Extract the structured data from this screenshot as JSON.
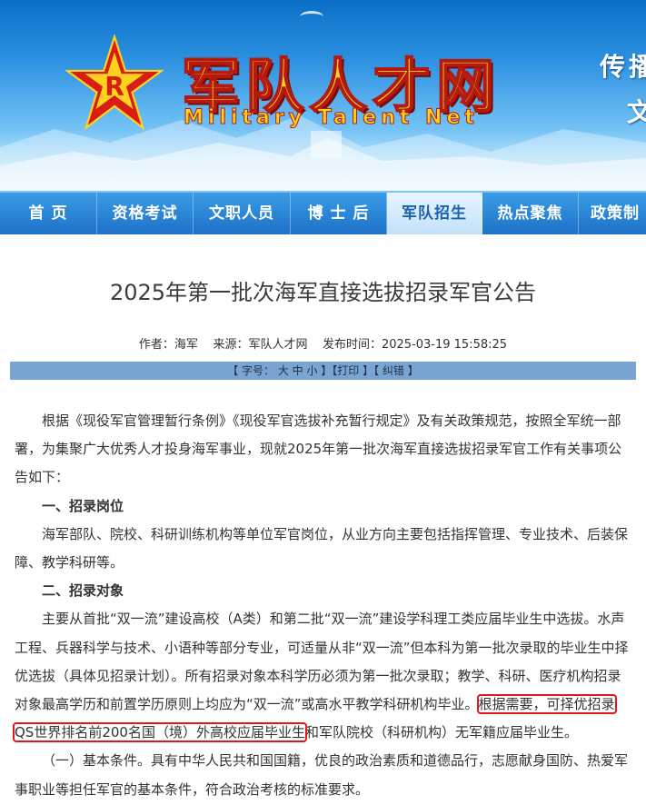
{
  "banner": {
    "logo_cn": "军队人才网",
    "logo_en": "Military Talent Net",
    "slogan_line1": "传播",
    "slogan_line2": "文"
  },
  "nav": {
    "items": [
      {
        "label": "首 页",
        "active": false
      },
      {
        "label": "资格考试",
        "active": false
      },
      {
        "label": "文职人员",
        "active": false
      },
      {
        "label": "博 士 后",
        "active": false
      },
      {
        "label": "军队招生",
        "active": true
      },
      {
        "label": "热点聚焦",
        "active": false
      },
      {
        "label": "政策制",
        "active": false
      }
    ]
  },
  "article": {
    "title": "2025年第一批次海军直接选拔招录军官公告",
    "meta": "作者：海军    来源：军队人才网    发布时间：2025-03-19 15:58:25",
    "toolbar": "【 字号： 大 中 小 】【打印 】【 纠错 】",
    "intro": "根据《现役军官管理暂行条例》《现役军官选拔补充暂行规定》及有关政策规范，按照全军统一部署，为集聚广大优秀人才投身海军事业，现就2025年第一批次海军直接选拔招录军官工作有关事项公告如下：",
    "section1_heading": "一、招录岗位",
    "section1_text": "海军部队、院校、科研训练机构等单位军官岗位，从业方向主要包括指挥管理、专业技术、后装保障、教学科研等。",
    "section2_heading": "二、招录对象",
    "section2_text_a": "主要从首批“双一流”建设高校（A类）和第二批“双一流”建设学科理工类应届毕业生中选拔。水声工程、兵器科学与技术、小语种等部分专业，可适量从非“双一流”但本科为第一批次录取的毕业生中择优选拔（具体见招录计划）。所有招录对象本科学历必须为第一批次录取；教学、科研、医疗机构招录对象最高学历和前置学历原则上均应为“双一流”或高水平教学科研机构毕业。",
    "section2_highlight": "根据需要，可择优招录QS世界排名前200名国（境）外高校应届毕业生",
    "section2_text_b": "和军队院校（科研机构）无军籍应届毕业生。",
    "sub1": "（一）基本条件。具有中华人民共和国国籍，优良的政治素质和道德品行，志愿献身国防、热爱军事职业等担任军官的基本条件，符合政治考核的标准要求。"
  },
  "colors": {
    "nav_blue": "#1d70c6",
    "highlight_red": "#e3161c",
    "toolbar_bg": "#7aa5d3"
  }
}
